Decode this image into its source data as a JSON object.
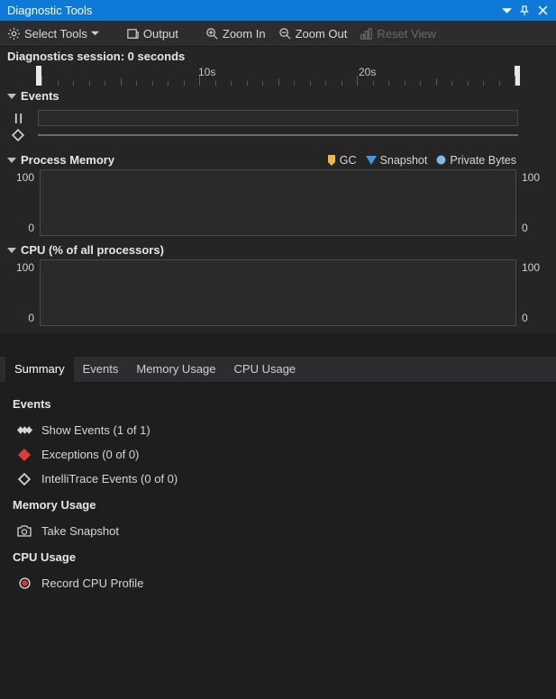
{
  "title": "Diagnostic Tools",
  "toolbar": {
    "select_tools": "Select Tools",
    "output": "Output",
    "zoom_in": "Zoom In",
    "zoom_out": "Zoom Out",
    "reset_view": "Reset View"
  },
  "session_label": "Diagnostics session: 0 seconds",
  "ruler": {
    "t1": "10s",
    "t2": "20s"
  },
  "sections": {
    "events": "Events",
    "memory": "Process Memory",
    "cpu": "CPU (% of all processors)"
  },
  "legend": {
    "gc": "GC",
    "snapshot": "Snapshot",
    "private_bytes": "Private Bytes"
  },
  "axes": {
    "top": "100",
    "bottom": "0"
  },
  "tabs": {
    "summary": "Summary",
    "events": "Events",
    "memory": "Memory Usage",
    "cpu": "CPU Usage",
    "active": "summary"
  },
  "detail": {
    "events_title": "Events",
    "show_events": "Show Events (1 of 1)",
    "exceptions": "Exceptions (0 of 0)",
    "intellitrace": "IntelliTrace Events (0 of 0)",
    "memory_title": "Memory Usage",
    "take_snapshot": "Take Snapshot",
    "cpu_title": "CPU Usage",
    "record_cpu": "Record CPU Profile"
  },
  "chart_data": [
    {
      "type": "line",
      "title": "Process Memory",
      "xlabel": "",
      "ylabel": "",
      "ylim": [
        0,
        100
      ],
      "x": [],
      "values": [],
      "series_legend": [
        "GC",
        "Snapshot",
        "Private Bytes"
      ]
    },
    {
      "type": "line",
      "title": "CPU (% of all processors)",
      "xlabel": "",
      "ylabel": "",
      "ylim": [
        0,
        100
      ],
      "x": [],
      "values": []
    }
  ]
}
